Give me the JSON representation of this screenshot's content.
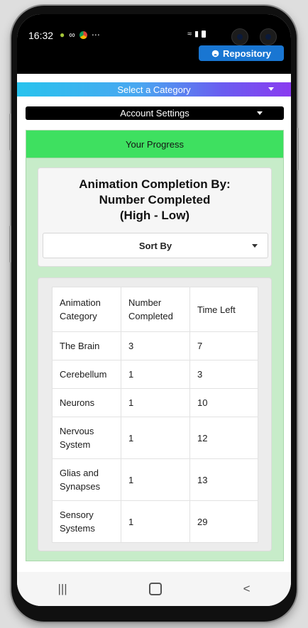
{
  "status_bar": {
    "time": "16:32",
    "left_icons": [
      "android-icon",
      "link-icon",
      "chrome-icon",
      "more-icon"
    ],
    "right_icons": [
      "wifi-icon",
      "signal-icon",
      "battery-icon"
    ]
  },
  "header": {
    "repository_label": "Repository"
  },
  "category_select": {
    "selected": "Select a Category"
  },
  "account_select": {
    "selected": "Account Settings"
  },
  "progress": {
    "heading": "Your Progress",
    "title_line1": "Animation Completion By:",
    "title_line2": "Number Completed",
    "title_line3": "(High - Low)",
    "sort_label": "Sort By"
  },
  "table": {
    "headers": [
      "Animation Category",
      "Number Completed",
      "Time Left"
    ],
    "rows": [
      {
        "category": "The Brain",
        "number": "3",
        "time_left": "7"
      },
      {
        "category": "Cerebellum",
        "number": "1",
        "time_left": "3"
      },
      {
        "category": "Neurons",
        "number": "1",
        "time_left": "10"
      },
      {
        "category": "Nervous System",
        "number": "1",
        "time_left": "12"
      },
      {
        "category": "Glias and Synapses",
        "number": "1",
        "time_left": "13"
      },
      {
        "category": "Sensory Systems",
        "number": "1",
        "time_left": "29"
      }
    ]
  },
  "navbar": {
    "recents": "|||",
    "back": "<"
  },
  "colors": {
    "progress_header": "#3ee060",
    "progress_panel": "#c7ecc9",
    "repo_button": "#1976d2",
    "category_gradient_start": "#27c3ee",
    "category_gradient_end": "#8a3bf0"
  }
}
